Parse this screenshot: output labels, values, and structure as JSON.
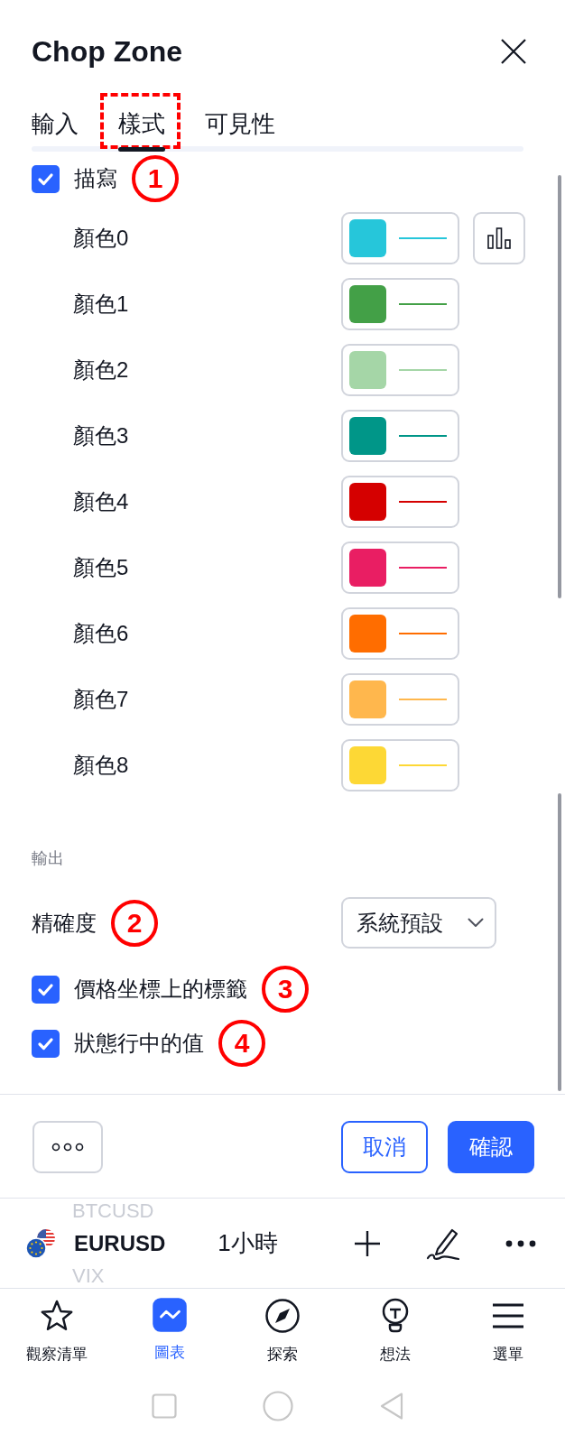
{
  "dialog": {
    "title": "Chop Zone"
  },
  "tabs": [
    {
      "label": "輸入",
      "selected": false,
      "highlighted": false
    },
    {
      "label": "樣式",
      "selected": true,
      "highlighted": true
    },
    {
      "label": "可見性",
      "selected": false,
      "highlighted": false
    }
  ],
  "plot": {
    "label": "描寫",
    "checked": true,
    "marker": "1"
  },
  "colors": [
    {
      "label": "顏色0",
      "color": "#26c6da",
      "kind": "with_style"
    },
    {
      "label": "顏色1",
      "color": "#43a047",
      "kind": "plain"
    },
    {
      "label": "顏色2",
      "color": "#a5d6a7",
      "kind": "plain"
    },
    {
      "label": "顏色3",
      "color": "#009688",
      "kind": "plain"
    },
    {
      "label": "顏色4",
      "color": "#d50000",
      "kind": "plain"
    },
    {
      "label": "顏色5",
      "color": "#e91e63",
      "kind": "plain"
    },
    {
      "label": "顏色6",
      "color": "#ff6d00",
      "kind": "plain"
    },
    {
      "label": "顏色7",
      "color": "#ffb74d",
      "kind": "plain"
    },
    {
      "label": "顏色8",
      "color": "#fdd835",
      "kind": "plain"
    }
  ],
  "output": {
    "heading": "輸出",
    "precision": {
      "label": "精確度",
      "value": "系統預設",
      "marker": "2"
    },
    "options": [
      {
        "label": "價格坐標上的標籤",
        "checked": true,
        "marker": "3"
      },
      {
        "label": "狀態行中的值",
        "checked": true,
        "marker": "4"
      }
    ]
  },
  "footer": {
    "buttons": [
      {
        "label": "取消",
        "kind": "secondary"
      },
      {
        "label": "確認",
        "kind": "primary"
      }
    ]
  },
  "symbol_bar": {
    "previous": "BTCUSD",
    "symbol": "EURUSD",
    "interval": "1小時",
    "next": "VIX"
  },
  "bottom_nav": [
    {
      "label": "觀察清單",
      "kind": "watchlist",
      "selected": false
    },
    {
      "label": "圖表",
      "kind": "chart",
      "selected": true
    },
    {
      "label": "探索",
      "kind": "explore",
      "selected": false
    },
    {
      "label": "想法",
      "kind": "ideas",
      "selected": false
    },
    {
      "label": "選單",
      "kind": "menu",
      "selected": false
    }
  ]
}
